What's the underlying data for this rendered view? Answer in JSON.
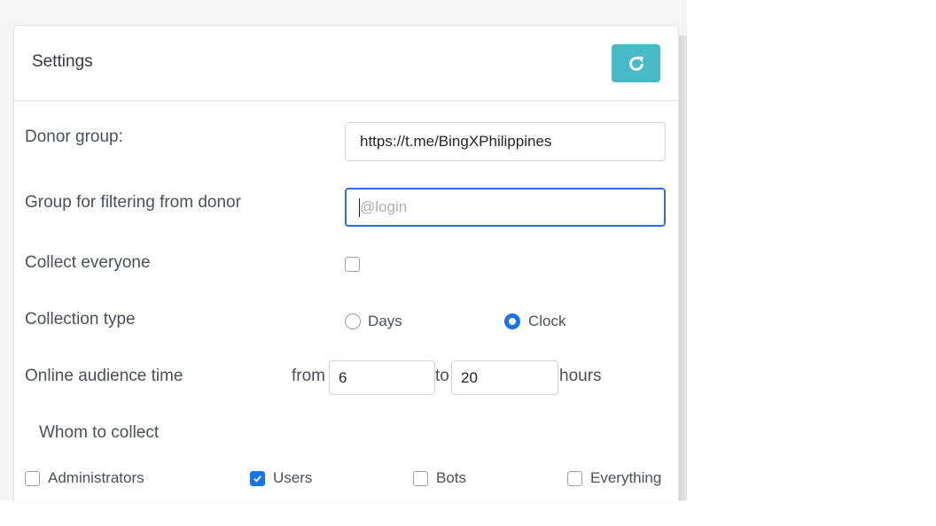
{
  "card": {
    "title": "Settings",
    "refresh_icon": "refresh-icon"
  },
  "donor_group": {
    "label": "Donor group:",
    "value": "https://t.me/BingXPhilippines"
  },
  "filter_group": {
    "label": "Group for filtering from donor",
    "placeholder": "@login",
    "value": ""
  },
  "collect_everyone": {
    "label": "Collect everyone",
    "checked": false
  },
  "collection_type": {
    "label": "Collection type",
    "options": [
      {
        "label": "Days",
        "selected": false
      },
      {
        "label": "Clock",
        "selected": true
      }
    ]
  },
  "online_time": {
    "label": "Online audience time",
    "from_label": "from",
    "from_value": "6",
    "to_label": "to",
    "to_value": "20",
    "unit": "hours"
  },
  "whom": {
    "heading": "Whom to collect",
    "options": [
      {
        "label": "Administrators",
        "checked": false
      },
      {
        "label": "Users",
        "checked": true
      },
      {
        "label": "Bots",
        "checked": false
      },
      {
        "label": "Everything",
        "checked": false
      }
    ]
  },
  "colors": {
    "accent": "#48b9c6",
    "checked": "#1a73e8",
    "focus": "#2d6be0"
  }
}
